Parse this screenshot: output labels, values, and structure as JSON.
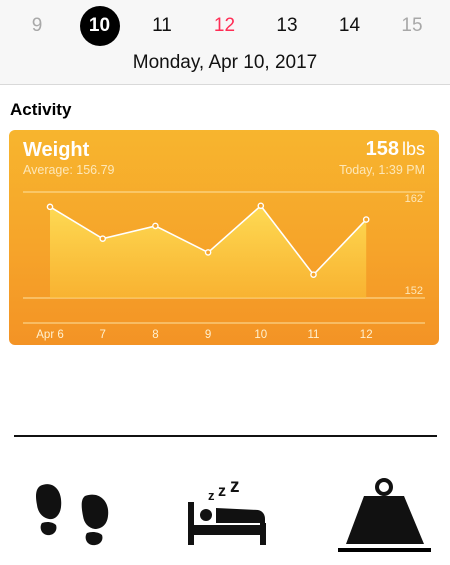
{
  "days": [
    {
      "label": "9",
      "state": "weekend"
    },
    {
      "label": "10",
      "state": "selected"
    },
    {
      "label": "11",
      "state": "normal"
    },
    {
      "label": "12",
      "state": "today"
    },
    {
      "label": "13",
      "state": "normal"
    },
    {
      "label": "14",
      "state": "normal"
    },
    {
      "label": "15",
      "state": "weekend"
    }
  ],
  "full_date": "Monday, Apr 10, 2017",
  "section_title": "Activity",
  "card": {
    "title": "Weight",
    "value": "158",
    "unit": "lbs",
    "average": "Average: 156.79",
    "timestamp": "Today, 1:39 PM"
  },
  "colors": {
    "accent": "#ff2d55",
    "card_orange": "#f6a42a"
  },
  "tabs": [
    {
      "icon": "footprints-icon",
      "selected": false
    },
    {
      "icon": "sleep-bed-icon",
      "selected": false
    },
    {
      "icon": "weight-icon",
      "selected": true
    }
  ],
  "chart_data": {
    "type": "area",
    "categories": [
      "Apr 6",
      "7",
      "8",
      "9",
      "10",
      "11",
      "12"
    ],
    "values": [
      160.6,
      157.6,
      158.8,
      156.3,
      160.7,
      154.2,
      159.4
    ],
    "ylim": [
      152,
      162
    ],
    "ytick_labels": [
      "162",
      "152"
    ]
  }
}
